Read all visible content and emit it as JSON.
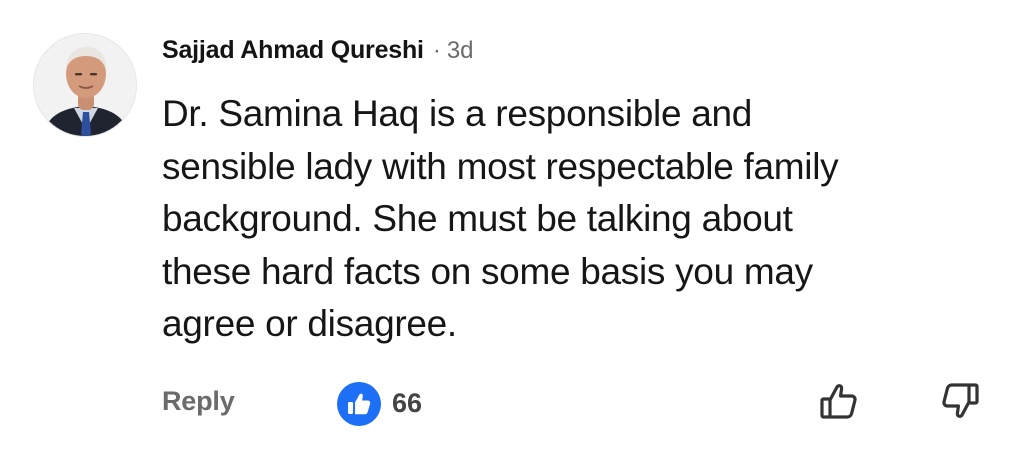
{
  "comment": {
    "author": "Sajjad Ahmad Qureshi",
    "separator": "·",
    "time": "3d",
    "text": "Dr. Samina Haq is a responsible and\nsensible lady with most respectable family\nbackground. She must be talking about\nthese hard facts on some basis you may\nagree or disagree.",
    "avatar_icon": "profile-photo"
  },
  "actions": {
    "reply_label": "Reply",
    "like_icon": "like-icon",
    "like_count": "66",
    "thumb_up_icon": "thumbs-up-outline-icon",
    "thumb_down_icon": "thumbs-down-outline-icon"
  },
  "colors": {
    "like_badge": "#1d6ff5",
    "muted_text": "#6b6b6b",
    "body_text": "#161616"
  }
}
